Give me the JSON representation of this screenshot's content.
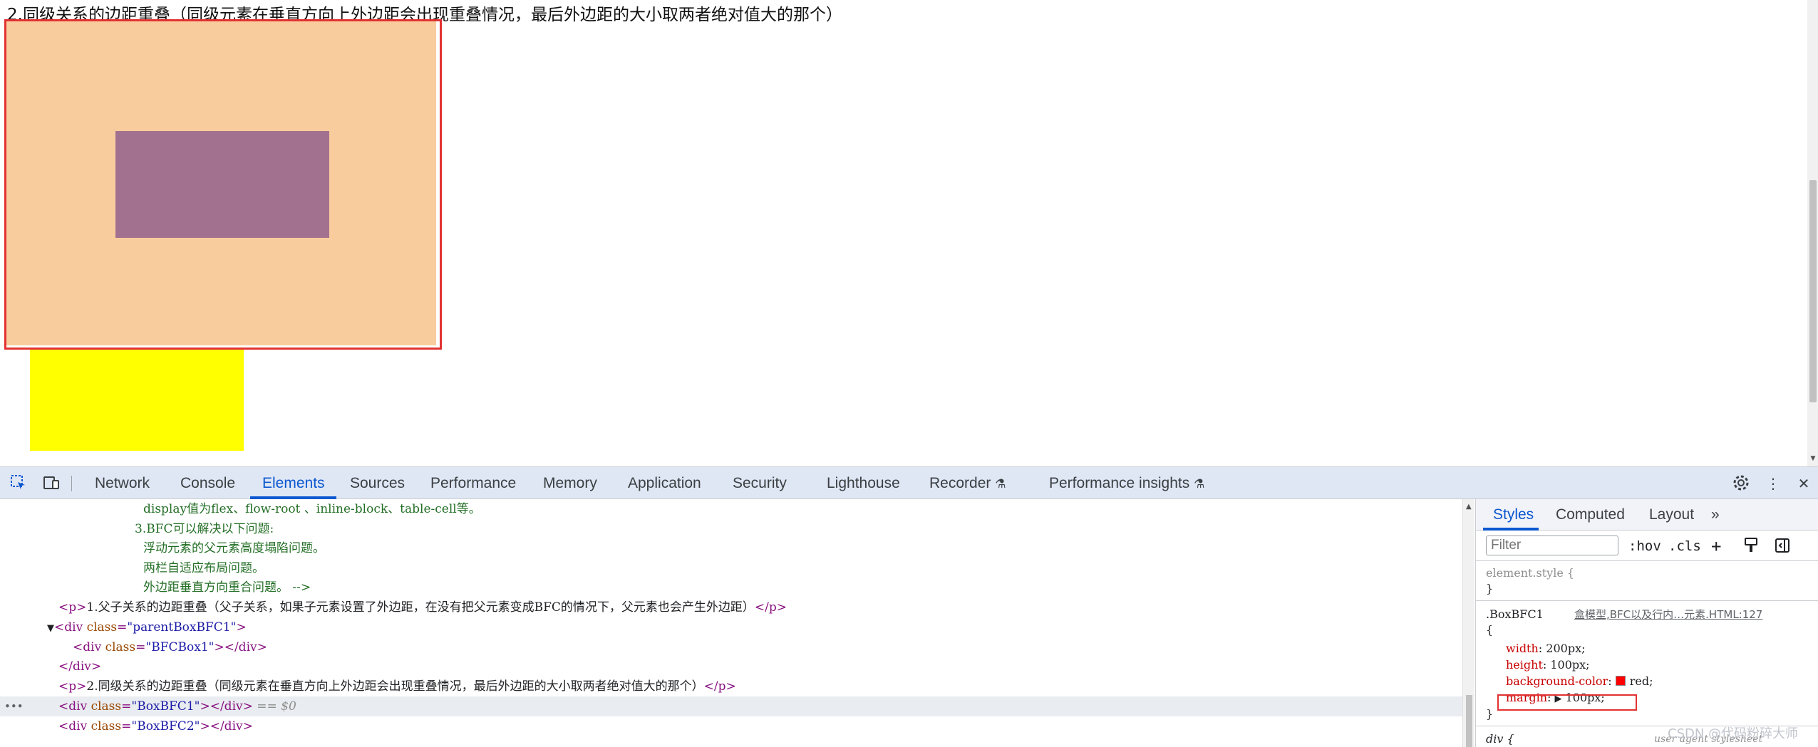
{
  "page": {
    "heading_text": "2.同级关系的边距重叠（同级元素在垂直方向上外边距会出现重叠情况，最后外边距的大小取两者绝对值大的那个）"
  },
  "devtools": {
    "tabs": [
      "Network",
      "Console",
      "Elements",
      "Sources",
      "Performance",
      "Memory",
      "Application",
      "Security",
      "Lighthouse",
      "Recorder",
      "Performance insights"
    ],
    "active_tab": "Elements",
    "elements": {
      "comment_lines": [
        "display值为flex、flow-root 、inline-block、table-cell等。",
        "3.BFC可以解决以下问题:",
        "浮动元素的父元素高度塌陷问题。",
        "两栏自适应布局问题。",
        "外边距垂直方向重合问题。 -->"
      ],
      "p1_text": "1.父子关系的边距重叠（父子关系，如果子元素设置了外边距，在没有把父元素变成BFC的情况下，父元素也会产生外边距）",
      "parent_class": "parentBoxBFC1",
      "child_class": "BFCBox1",
      "p2_text": "2.同级关系的边距重叠（同级元素在垂直方向上外边距会出现重叠情况，最后外边距的大小取两者绝对值大的那个）",
      "box1_class": "BoxBFC1",
      "box2_class": "BoxBFC2",
      "selected_marker": "== $0"
    },
    "styles": {
      "tabs": [
        "Styles",
        "Computed",
        "Layout"
      ],
      "active_tab": "Styles",
      "filter_placeholder": "Filter",
      "hov_label": ":hov",
      "cls_label": ".cls",
      "element_style": "element.style {",
      "close_brace": "}",
      "rule_selector": ".BoxBFC1",
      "rule_source": "盒模型,BFC以及行内…元素.HTML:127",
      "open_brace": "{",
      "declarations": [
        {
          "prop": "width",
          "value": "200px;"
        },
        {
          "prop": "height",
          "value": "100px;"
        },
        {
          "prop": "background-color",
          "value": "red;"
        },
        {
          "prop": "margin",
          "value": "100px;"
        }
      ],
      "next_rule": "div {",
      "user_agent": "user agent stylesheet"
    },
    "watermark": "CSDN @代码粉碎大师"
  },
  "colors": {
    "accent": "#0b57d0",
    "margin_highlight": "#f9cc9d",
    "content_highlight": "#a2718f",
    "yellow_box": "#ffff00",
    "selection_outline": "#e23232"
  }
}
